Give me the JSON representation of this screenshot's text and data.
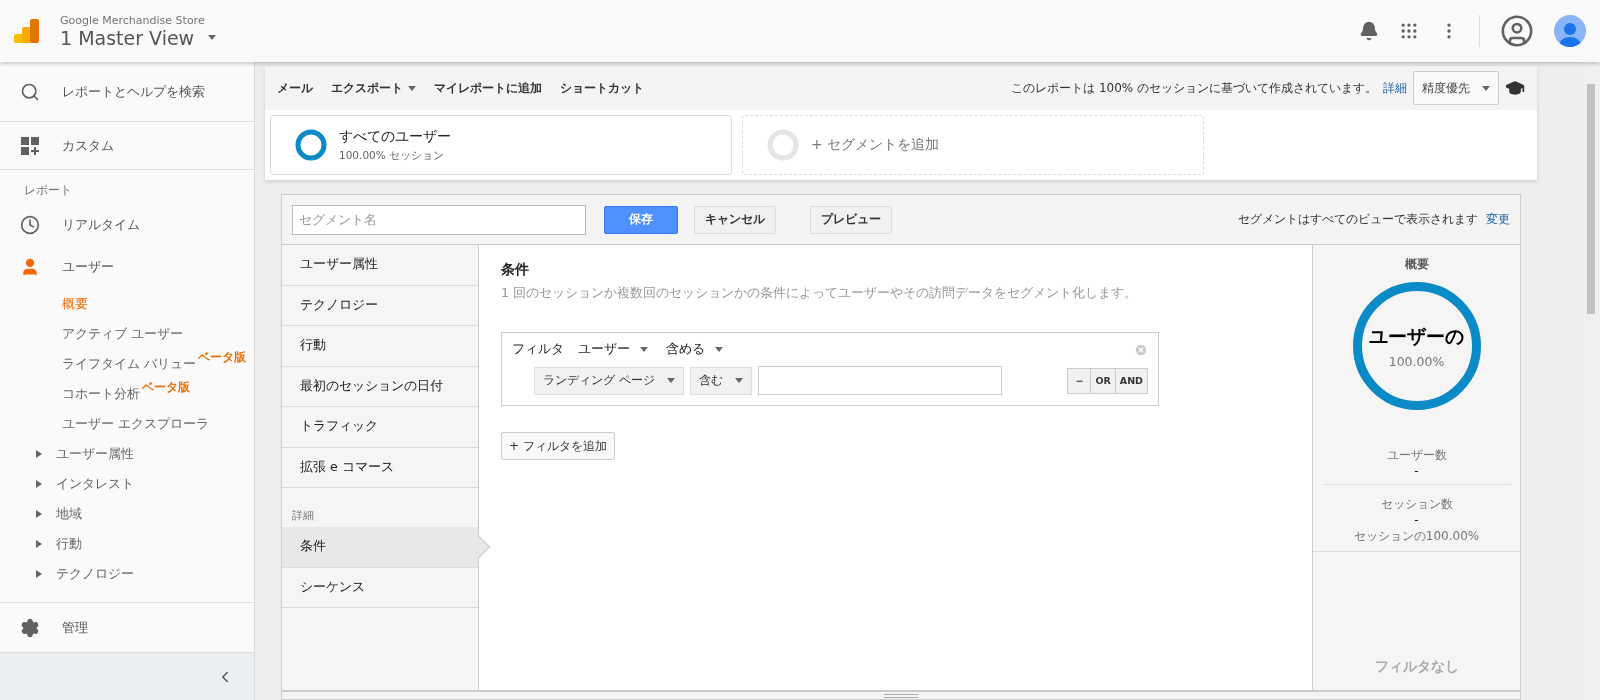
{
  "header": {
    "account": "Google Merchandise Store",
    "view": "1 Master View"
  },
  "sidebar": {
    "search": "レポートとヘルプを検索",
    "custom": "カスタム",
    "section_label": "レポート",
    "realtime": "リアルタイム",
    "user": {
      "label": "ユーザー",
      "active": true,
      "children": [
        {
          "label": "概要",
          "selected": true
        },
        {
          "label": "アクティブ ユーザー",
          "selected": false
        },
        {
          "label": "ライフタイム バリュー",
          "selected": false,
          "badge": "ベータ版"
        },
        {
          "label": "コホート分析",
          "selected": false,
          "badge": "ベータ版"
        },
        {
          "label": "ユーザー エクスプローラ",
          "selected": false
        }
      ],
      "groups": [
        {
          "label": "ユーザー属性",
          "expanded": false
        },
        {
          "label": "インタレスト",
          "expanded": false
        },
        {
          "label": "地域",
          "expanded": false
        },
        {
          "label": "行動",
          "expanded": false
        },
        {
          "label": "テクノロジー",
          "expanded": false
        }
      ]
    },
    "admin": "管理"
  },
  "toolbar": {
    "actions": [
      {
        "label": "メール",
        "dropdown": false
      },
      {
        "label": "エクスポート",
        "dropdown": true
      },
      {
        "label": "マイレポートに追加",
        "dropdown": false
      },
      {
        "label": "ショートカット",
        "dropdown": false
      }
    ],
    "sampling_note": "このレポートは 100% のセッションに基づいて作成されています。",
    "detail_link": "詳細",
    "precision": "精度優先"
  },
  "segments": [
    {
      "kind": "segment",
      "name": "すべてのユーザー",
      "detail": "100.00% セッション"
    },
    {
      "kind": "add",
      "name": "+ セグメントを追加"
    }
  ],
  "editor": {
    "name_placeholder": "セグメント名",
    "save": "保存",
    "cancel": "キャンセル",
    "preview": "プレビュー",
    "visibility_note": "セグメントはすべてのビューで表示されます",
    "change_link": "変更",
    "categories": [
      {
        "kind": "item",
        "label": "ユーザー属性",
        "selected": false
      },
      {
        "kind": "item",
        "label": "テクノロジー",
        "selected": false
      },
      {
        "kind": "item",
        "label": "行動",
        "selected": false
      },
      {
        "kind": "item",
        "label": "最初のセッションの日付",
        "selected": false
      },
      {
        "kind": "item",
        "label": "トラフィック",
        "selected": false
      },
      {
        "kind": "item",
        "label": "拡張 e コマース",
        "selected": false
      },
      {
        "kind": "heading",
        "label": "詳細"
      },
      {
        "kind": "item",
        "label": "条件",
        "selected": true
      },
      {
        "kind": "item",
        "label": "シーケンス",
        "selected": false
      }
    ],
    "condition": {
      "title": "条件",
      "description": "1 回のセッションか複数回のセッションかの条件によってユーザーやその訪問データをセグメント化します。",
      "filter": {
        "label": "フィルタ",
        "scope": "ユーザー",
        "mode": "含める",
        "dimension": "ランディング ページ",
        "operator": "含む",
        "logic": [
          "−",
          "OR",
          "AND"
        ]
      },
      "add_filter": "+ フィルタを追加"
    },
    "summary": {
      "title": "概要",
      "ring_label": "ユーザーの",
      "ring_percent": "100.00%",
      "stats": [
        {
          "label": "ユーザー数",
          "value": "-"
        },
        {
          "label": "セッション数",
          "value": "-",
          "note": "セッションの100.00%"
        }
      ],
      "footer": "フィルタなし"
    }
  }
}
